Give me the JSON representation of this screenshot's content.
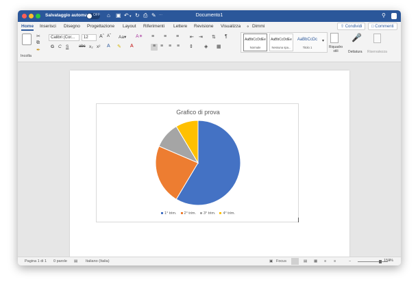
{
  "titlebar": {
    "autosave_label": "Salvataggio automatico",
    "autosave_state": "OFF",
    "document_title": "Documento1"
  },
  "tabs": [
    "Home",
    "Inserisci",
    "Disegno",
    "Progettazione",
    "Layout",
    "Riferimenti",
    "Lettere",
    "Revisione",
    "Visualizza"
  ],
  "tell_me": "Dimmi",
  "share_label": "Condividi",
  "comments_label": "Commenti",
  "ribbon": {
    "paste_label": "Incolla",
    "font_name": "Calibri (Cor...",
    "font_size": "12",
    "bold": "G",
    "italic": "C",
    "underline": "S",
    "strike": "abc",
    "subscript": "x₂",
    "superscript": "x²",
    "styles": [
      {
        "sample": "AaBbCcDdEe",
        "name": "Normale"
      },
      {
        "sample": "AaBbCcDdEe",
        "name": "Nessuna spa..."
      },
      {
        "sample": "AaBbCcDc",
        "name": "Titolo 1"
      }
    ],
    "styles_pane_label": "Riquadro\nstili",
    "dictate_label": "Dettatura",
    "sensitivity_label": "Riservatezza"
  },
  "chart_data": {
    "type": "pie",
    "title": "Grafico di prova",
    "categories": [
      "1° trim.",
      "2° trim.",
      "3° trim.",
      "4° trim."
    ],
    "values": [
      8.2,
      3.2,
      1.4,
      1.2
    ],
    "colors": [
      "#4472c4",
      "#ed7d31",
      "#a5a5a5",
      "#ffc000"
    ],
    "legend_position": "bottom"
  },
  "status": {
    "page": "Pagina 1 di 1",
    "words": "0 parole",
    "language": "Italiano (Italia)",
    "focus": "Focus",
    "zoom": "150%",
    "zoom_fraction": 0.75
  }
}
